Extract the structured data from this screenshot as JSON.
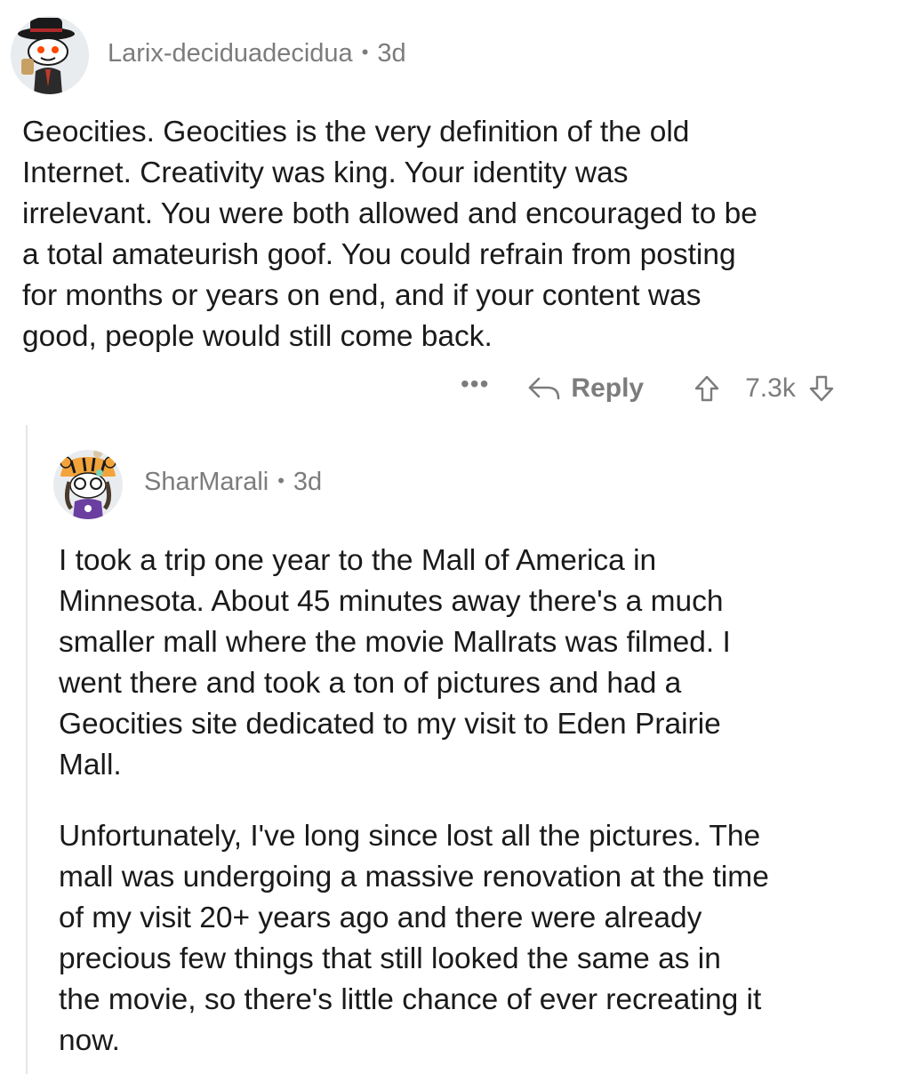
{
  "comments": [
    {
      "username": "Larix-deciduadecidua",
      "separator": "•",
      "age": "3d",
      "avatar_icon": "snoo-detective-avatar-icon",
      "paragraphs": [
        "Geocities. Geocities is the very definition of the old\nInternet. Creativity was king. Your identity was\nirrelevant. You were both allowed and encouraged to be\na total amateurish goof. You could refrain from posting\nfor months or years on end, and if your content was\ngood, people would still come back."
      ],
      "more_label": "•••",
      "reply_label": "Reply",
      "score": "7.3k"
    },
    {
      "username": "SharMarali",
      "separator": "•",
      "age": "3d",
      "avatar_icon": "tiger-hat-avatar-icon",
      "paragraphs": [
        "I took a trip one year to the Mall of America in\nMinnesota. About 45 minutes away there's a much\nsmaller mall where the movie Mallrats was filmed. I\nwent there and took a ton of pictures and had a\nGeocities site dedicated to my visit to Eden Prairie\nMall.",
        "Unfortunately, I've long since lost all the pictures. The\nmall was undergoing a massive renovation at the time\nof my visit 20+ years ago and there were already\nprecious few things that still looked the same as in\nthe movie, so there's little chance of ever recreating it\nnow."
      ]
    }
  ],
  "colors": {
    "text": "#1a1a1b",
    "meta": "#7c7c7c",
    "thread_line": "#e6e6e6"
  }
}
